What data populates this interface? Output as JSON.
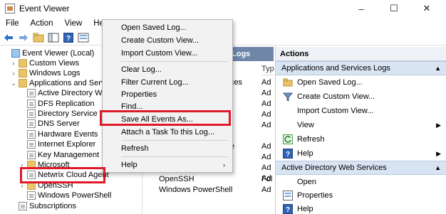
{
  "window": {
    "title": "Event Viewer",
    "controls": {
      "minimize": "–",
      "maximize": "☐",
      "close": "✕"
    }
  },
  "menubar": [
    "File",
    "Action",
    "View",
    "Help"
  ],
  "toolbar": {
    "icons": [
      "back-icon",
      "forward-icon",
      "folder-up-icon",
      "show-hide-icon",
      "help-icon",
      "properties-icon"
    ]
  },
  "tree": {
    "items": [
      {
        "label": "Event Viewer (Local)",
        "chev": "",
        "icon": "pc"
      },
      {
        "label": "Custom Views",
        "chev": "›",
        "icon": "folder"
      },
      {
        "label": "Windows Logs",
        "chev": "›",
        "icon": "folder"
      },
      {
        "label": "Applications and Services",
        "chev": "⌄",
        "icon": "folder"
      },
      {
        "label": "Active Directory Web",
        "chev": "",
        "icon": "log"
      },
      {
        "label": "DFS Replication",
        "chev": "",
        "icon": "log"
      },
      {
        "label": "Directory Service",
        "chev": "",
        "icon": "log"
      },
      {
        "label": "DNS Server",
        "chev": "",
        "icon": "log"
      },
      {
        "label": "Hardware Events",
        "chev": "",
        "icon": "log"
      },
      {
        "label": "Internet Explorer",
        "chev": "",
        "icon": "log"
      },
      {
        "label": "Key Management Ser",
        "chev": "",
        "icon": "log"
      },
      {
        "label": "Microsoft",
        "chev": "›",
        "icon": "folder"
      },
      {
        "label": "Netwrix Cloud Agent",
        "chev": "",
        "icon": "log"
      },
      {
        "label": "OpenSSH",
        "chev": "›",
        "icon": "folder"
      },
      {
        "label": "Windows PowerShell",
        "chev": "",
        "icon": "log"
      },
      {
        "label": "Subscriptions",
        "chev": "",
        "icon": "log"
      }
    ]
  },
  "center": {
    "header": "Logs",
    "column_type": "Typ",
    "rows": [
      {
        "name": "vices",
        "type": "Ad"
      },
      {
        "name": "",
        "type": "Ad"
      },
      {
        "name": "",
        "type": "Ad"
      },
      {
        "name": "",
        "type": "Ad"
      },
      {
        "name": "",
        "type": "Ad"
      },
      {
        "name": "e",
        "type": "Ad"
      },
      {
        "name": "",
        "type": "Ad"
      },
      {
        "name": "",
        "type": "Ad"
      },
      {
        "name": "",
        "type": "Ad"
      },
      {
        "name": "OpenSSH",
        "type": "Fol"
      },
      {
        "name": "Windows PowerShell",
        "type": "Ad"
      }
    ]
  },
  "actions": {
    "title": "Actions",
    "section1": "Applications and Services Logs",
    "items1": [
      {
        "label": "Open Saved Log...",
        "icon": "open-log-icon",
        "arrow": ""
      },
      {
        "label": "Create Custom View...",
        "icon": "filter-icon",
        "arrow": ""
      },
      {
        "label": "Import Custom View...",
        "icon": "",
        "arrow": ""
      },
      {
        "label": "View",
        "icon": "",
        "arrow": "▶"
      },
      {
        "label": "Refresh",
        "icon": "refresh-icon",
        "arrow": ""
      },
      {
        "label": "Help",
        "icon": "help-icon",
        "arrow": "▶"
      }
    ],
    "section2": "Active Directory Web Services",
    "items2": [
      {
        "label": "Open",
        "icon": "",
        "arrow": ""
      },
      {
        "label": "Properties",
        "icon": "properties-icon",
        "arrow": ""
      },
      {
        "label": "Help",
        "icon": "help-icon",
        "arrow": ""
      }
    ]
  },
  "context_menu": {
    "items": [
      "Open Saved Log...",
      "Create Custom View...",
      "Import Custom View...",
      "Clear Log...",
      "Filter Current Log...",
      "Properties",
      "Find...",
      "Save All Events As...",
      "Attach a Task To this Log...",
      "Refresh",
      "Help"
    ],
    "submenu_arrow": "›"
  },
  "colors": {
    "highlight_red": "#e0192a",
    "center_header": "#6f86a9",
    "actions_section": "#d9e4f3"
  }
}
